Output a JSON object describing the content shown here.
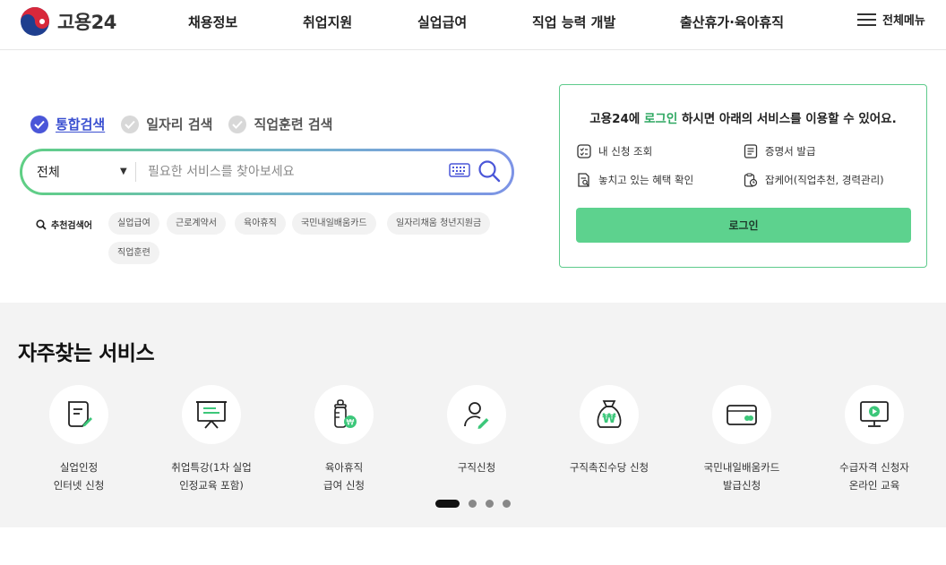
{
  "header": {
    "logo_text": "고용24",
    "nav": [
      "채용정보",
      "취업지원",
      "실업급여",
      "직업 능력 개발",
      "출산휴가·육아휴직"
    ],
    "menu_label": "전체메뉴"
  },
  "search": {
    "tabs": [
      {
        "label": "통합검색",
        "active": true
      },
      {
        "label": "일자리 검색",
        "active": false
      },
      {
        "label": "직업훈련 검색",
        "active": false
      }
    ],
    "scope": "전체",
    "scope_arrow": "▼",
    "placeholder": "필요한 서비스를 찾아보세요",
    "recommend_title": "추천검색어",
    "recommend": [
      "실업급여",
      "근로계약서",
      "육아휴직",
      "국민내일배움카드",
      "일자리채움 청년지원금",
      "직업훈련"
    ]
  },
  "login": {
    "title_prefix": "고용24에 ",
    "title_highlight": "로그인",
    "title_suffix": " 하시면 아래의 서비스를 이용할 수 있어요.",
    "services": [
      "내 신청 조회",
      "증명서 발급",
      "놓치고 있는 혜택 확인",
      "잡케어(직업추천, 경력관리)"
    ],
    "button": "로그인",
    "accent": "#2fa862"
  },
  "frequent": {
    "title": "자주찾는 서비스",
    "items": [
      {
        "label": "실업인정\n인터넷 신청",
        "icon": "document-pen-icon"
      },
      {
        "label": "취업특강(1차 실업\n인정교육 포함)",
        "icon": "presentation-board-icon"
      },
      {
        "label": "육아휴직\n급여 신청",
        "icon": "baby-bottle-icon"
      },
      {
        "label": "구직신청",
        "icon": "person-pen-icon"
      },
      {
        "label": "구직촉진수당 신청",
        "icon": "money-bag-icon"
      },
      {
        "label": "국민내일배움카드\n발급신청",
        "icon": "card-icon"
      },
      {
        "label": "수급자격 신청자\n온라인 교육",
        "icon": "monitor-play-icon"
      }
    ],
    "pages": 4,
    "current_page": 1
  },
  "colors": {
    "brand_green": "#5dd28e",
    "brand_blue": "#4a56d8",
    "icon_green": "#3cc77a"
  }
}
